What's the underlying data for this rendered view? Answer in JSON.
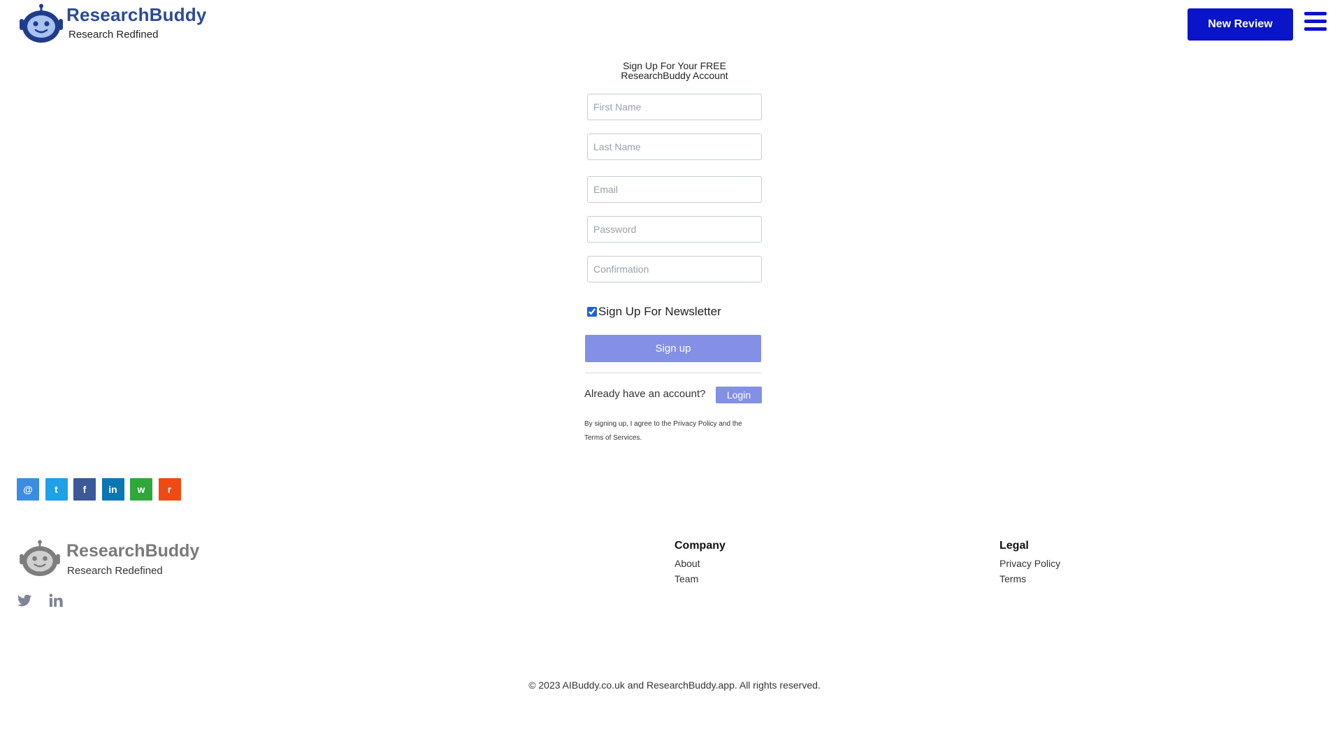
{
  "header": {
    "brand_title": "ResearchBuddy",
    "brand_subtitle": "Research Redfined",
    "new_review_label": "New Review",
    "menu_icon": "hamburger-menu-icon",
    "accent_color": "#0a14c8",
    "brand_color": "#2c4a9a"
  },
  "signup": {
    "title_line1": "Sign Up For Your FREE",
    "title_line2": "ResearchBuddy Account",
    "first_name_placeholder": "First Name",
    "last_name_placeholder": "Last Name",
    "email_placeholder": "Email",
    "password_placeholder": "Password",
    "confirmation_placeholder": "Confirmation",
    "newsletter_label": "Sign Up For Newsletter",
    "newsletter_checked": true,
    "signup_button_label": "Sign up",
    "have_account_text": "Already have an account?",
    "login_button_label": "Login",
    "legal_note_line1": "By signing up, I agree to the Privacy Policy and the",
    "legal_note_line2": "Terms of Services."
  },
  "share_icons": [
    {
      "name": "email-share-icon",
      "glyph": "@",
      "color": "#3b8de0"
    },
    {
      "name": "twitter-share-icon",
      "glyph": "t",
      "color": "#1ea1e6"
    },
    {
      "name": "facebook-share-icon",
      "glyph": "f",
      "color": "#3b5998"
    },
    {
      "name": "linkedin-share-icon",
      "glyph": "in",
      "color": "#0a77b5"
    },
    {
      "name": "whatsapp-share-icon",
      "glyph": "w",
      "color": "#2fa83a"
    },
    {
      "name": "reddit-share-icon",
      "glyph": "r",
      "color": "#f04a12"
    }
  ],
  "footer": {
    "brand_title": "ResearchBuddy",
    "brand_subtitle": "Research Redefined",
    "social": [
      "twitter-icon",
      "linkedin-icon"
    ],
    "company_heading": "Company",
    "company_links": [
      "About",
      "Team"
    ],
    "legal_heading": "Legal",
    "legal_links": [
      "Privacy Policy",
      "Terms"
    ],
    "copyright": "© 2023 AIBuddy.co.uk and ResearchBuddy.app. All rights reserved."
  }
}
